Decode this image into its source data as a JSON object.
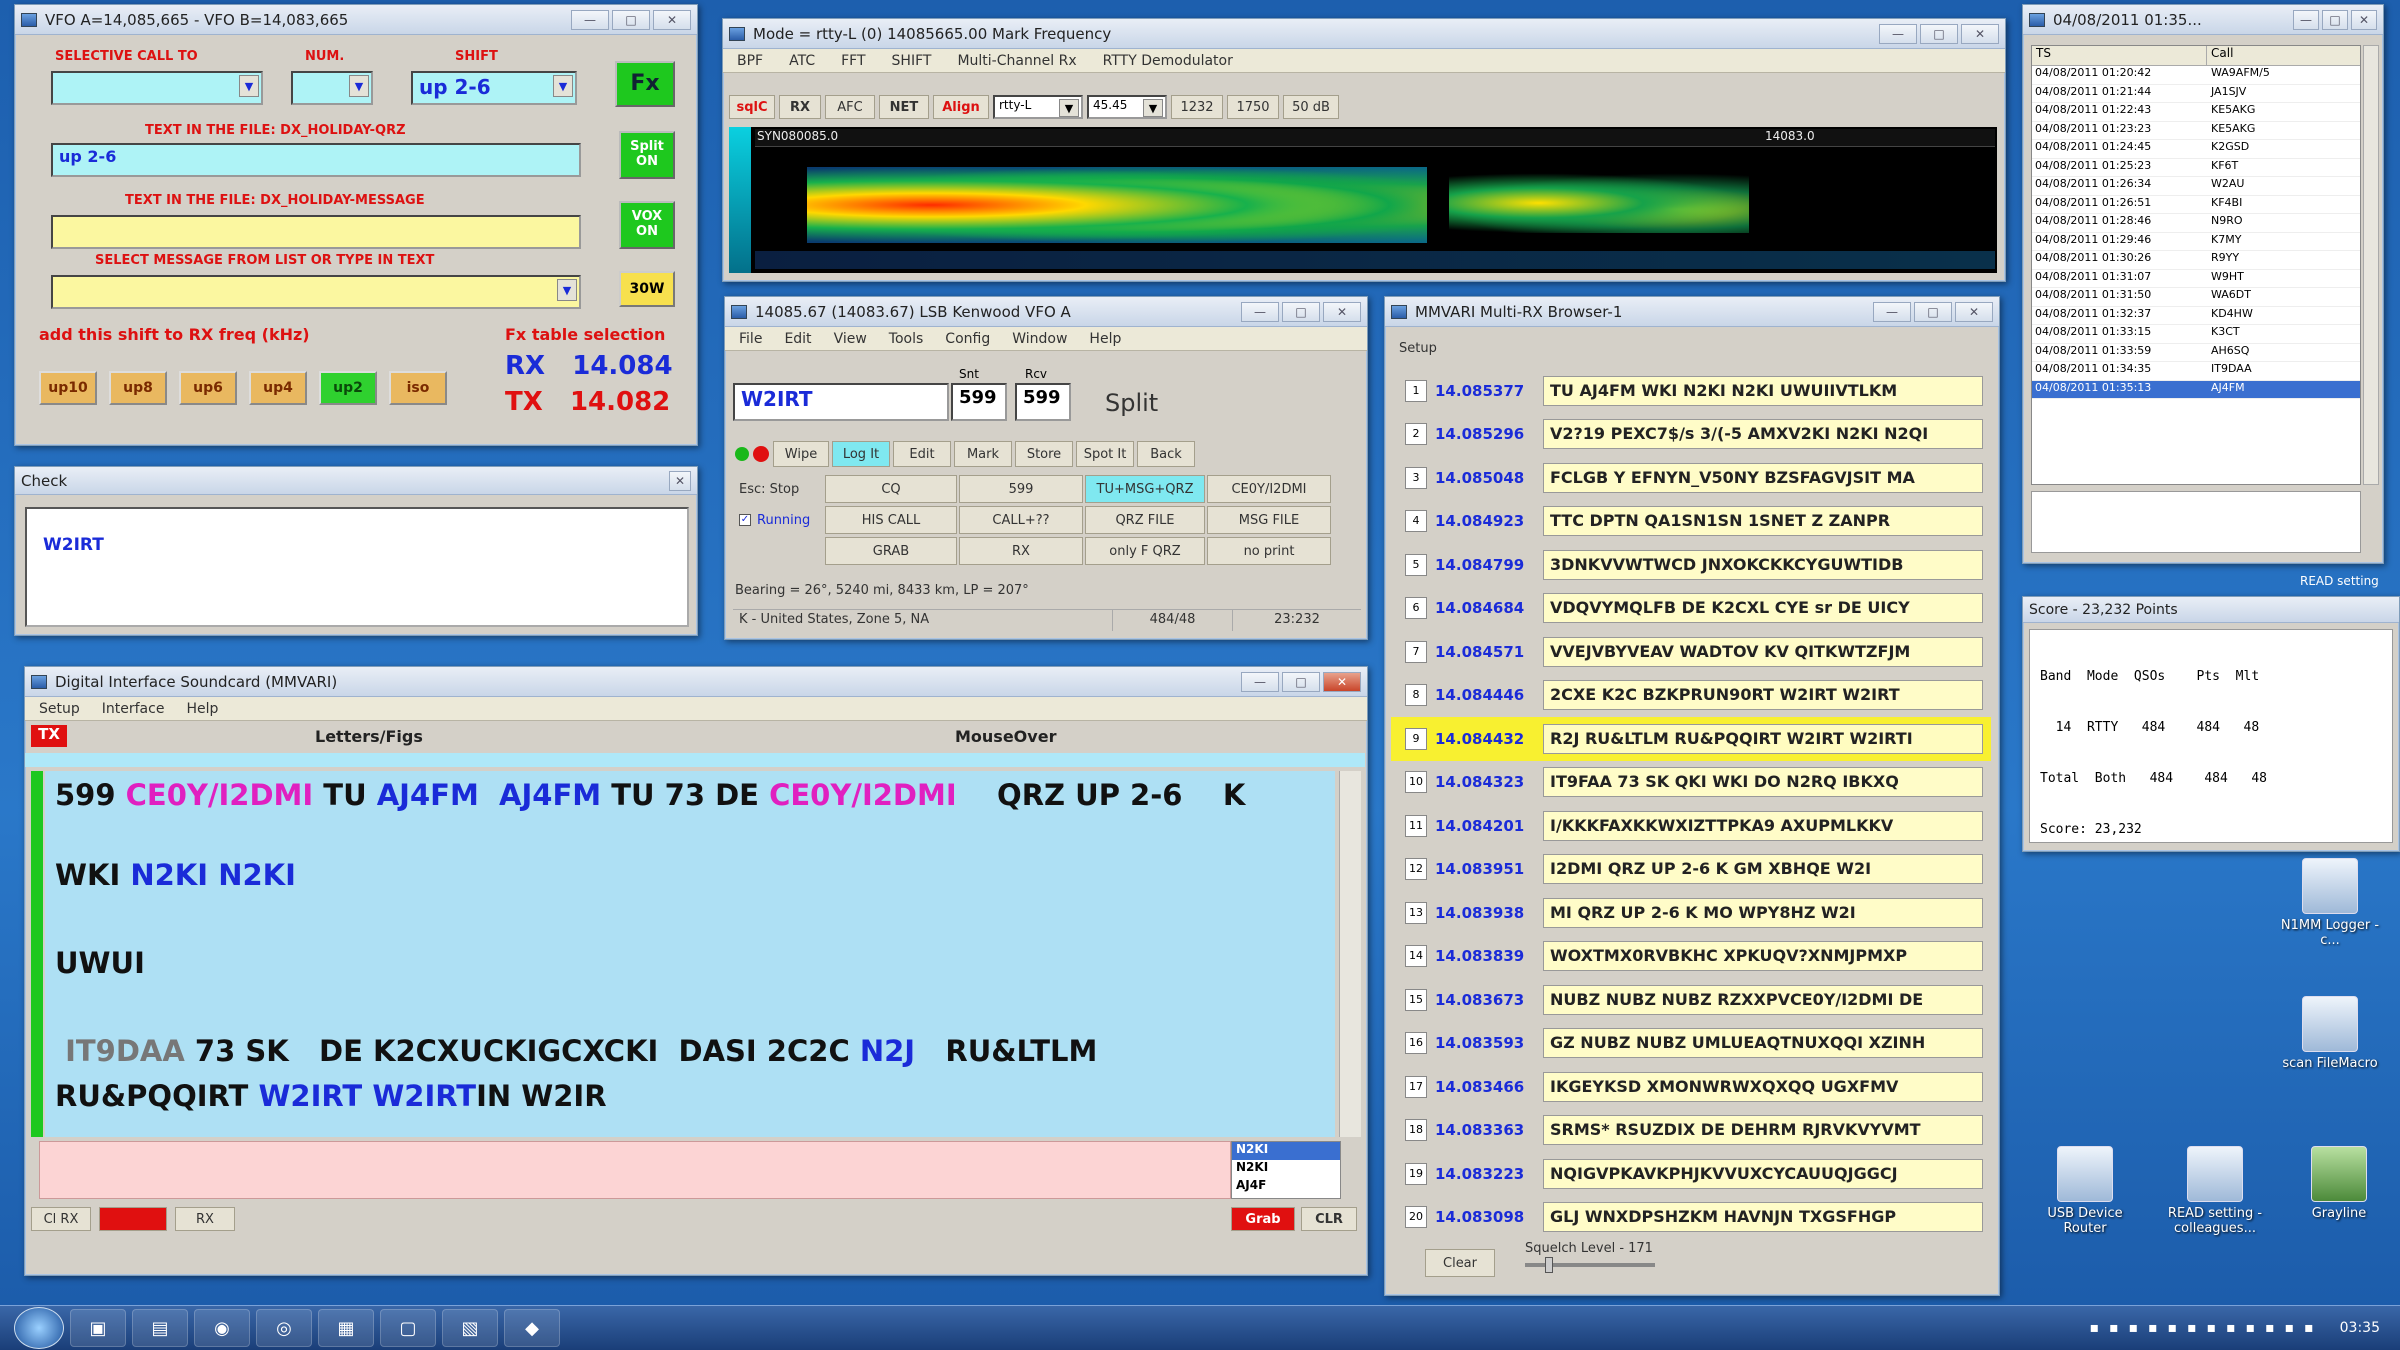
{
  "vfo": {
    "title": "VFO A=14,085,665 - VFO B=14,083,665",
    "selective_call_label": "SELECTIVE CALL TO",
    "num_label": "NUM.",
    "shift_label": "SHIFT",
    "shift_value": "up 2-6",
    "file_qrz_label": "TEXT IN THE FILE: DX_HOLIDAY-QRZ",
    "file_qrz_value": "up 2-6",
    "file_msg_label": "TEXT IN THE FILE: DX_HOLIDAY-MESSAGE",
    "select_msg_label": "SELECT MESSAGE FROM LIST OR TYPE IN TEXT",
    "shift_rx_label": "add this shift to RX freq (kHz)",
    "table_sel_label": "Fx table selection",
    "rx_label": "RX",
    "rx_value": "14.084",
    "tx_label": "TX",
    "tx_value": "14.082",
    "fx_btn": "Fx",
    "split_btn": "Split ON",
    "vox_btn": "VOX ON",
    "w_btn": "30W",
    "shift_buttons": [
      "up10",
      "up8",
      "up6",
      "up4",
      "up2",
      "iso"
    ],
    "active_shift": 4
  },
  "check": {
    "title": "Check",
    "value": "W2IRT"
  },
  "mode": {
    "title": "Mode = rtty-L (0) 14085665.00 Mark Frequency",
    "menu": [
      "BPF",
      "ATC",
      "FFT",
      "SHIFT",
      "Multi-Channel Rx",
      "RTTY Demodulator"
    ],
    "toolbar": [
      "sqlC",
      "RX",
      "AFC",
      "NET",
      "Align"
    ],
    "mode_value": "rtty-L",
    "baud_value": "45.45",
    "mark_value": "1232",
    "space_value": "1750",
    "shift_value": "50 dB",
    "waterfall_label_left": "SYN080085.0",
    "waterfall_label_right": "14083.0"
  },
  "logger": {
    "title": "14085.67 (14083.67) LSB Kenwood VFO A",
    "menu": [
      "File",
      "Edit",
      "View",
      "Tools",
      "Config",
      "Window",
      "Help"
    ],
    "snt_label": "Snt",
    "rcv_label": "Rcv",
    "call_value": "W2IRT",
    "snt_value": "599",
    "rcv_value": "599",
    "split_label": "Split",
    "toolbar": [
      "Wipe",
      "Log It",
      "Edit",
      "Mark",
      "Store",
      "Spot It",
      "Back"
    ],
    "grid": [
      [
        "Esc: Stop",
        "CQ",
        "599",
        "TU+MSG+QRZ",
        "CE0Y/I2DMI"
      ],
      [
        "Running",
        "HIS CALL",
        "CALL+??",
        "QRZ FILE",
        "MSG FILE"
      ],
      [
        "",
        "GRAB",
        "RX",
        "only F QRZ",
        "no print"
      ]
    ],
    "bearing": "Bearing = 26°, 5240 mi, 8433 km, LP = 207°",
    "country": "K - United States, Zone 5, NA",
    "qso_count": "484/48",
    "time": "23:232"
  },
  "multirx": {
    "title": "MMVARI Multi-RX Browser-1",
    "setup": "Setup",
    "rows": [
      {
        "n": "1",
        "freq": "14.085377",
        "text": "TU AJ4FM   WKI N2KI N2KI  UWUIIVTLKM"
      },
      {
        "n": "2",
        "freq": "14.085296",
        "text": "V2?19 PEXC7$/s 3/(-5 AMXV2KI N2KI N2QI"
      },
      {
        "n": "3",
        "freq": "14.085048",
        "text": "FCLGB Y EFNYN_V50NY BZSFAGVJSIT MA"
      },
      {
        "n": "4",
        "freq": "14.084923",
        "text": "TTC    DPTN QA1SN1SN  1SNET Z ZANPR"
      },
      {
        "n": "5",
        "freq": "14.084799",
        "text": "3DNKVVWTWCD JNXOKCKKCYGUWTIDB"
      },
      {
        "n": "6",
        "freq": "14.084684",
        "text": "VDQVYMQLFB DE K2CXL CYE sr DE UICY"
      },
      {
        "n": "7",
        "freq": "14.084571",
        "text": "VVEJVBYVEAV WADTOV KV QITKWTZFJM"
      },
      {
        "n": "8",
        "freq": "14.084446",
        "text": "2CXE K2C BZKPRUN90RT W2IRT W2IRT"
      },
      {
        "n": "9",
        "freq": "14.084432",
        "text": "R2J RU&LTLM RU&PQQIRT W2IRT W2IRTI"
      },
      {
        "n": "10",
        "freq": "14.084323",
        "text": "IT9FAA 73 SK QKI WKI DO N2RQ IBKXQ"
      },
      {
        "n": "11",
        "freq": "14.084201",
        "text": "I/KKKFAXKKWXIZTTPKA9   AXUPMLKKV"
      },
      {
        "n": "12",
        "freq": "14.083951",
        "text": "I2DMI     QRZ UP 2-6   K    GM XBHQE W2I"
      },
      {
        "n": "13",
        "freq": "14.083938",
        "text": "MI    QRZ UP 2-6   K    MO   WPY8HZ W2I"
      },
      {
        "n": "14",
        "freq": "14.083839",
        "text": "WOXTMX0RVBKHC XPKUQV?XNMJPMXP"
      },
      {
        "n": "15",
        "freq": "14.083673",
        "text": "NUBZ NUBZ NUBZ RZXXPVCE0Y/I2DMI DE"
      },
      {
        "n": "16",
        "freq": "14.083593",
        "text": "GZ NUBZ NUBZ UMLUEAQTNUXQQI XZINH"
      },
      {
        "n": "17",
        "freq": "14.083466",
        "text": "IKGEYKSD  XMONWRWXQXQQ UGXFMV"
      },
      {
        "n": "18",
        "freq": "14.083363",
        "text": "SRMS* RSUZDIX DE DEHRM RJRVKVYVMT"
      },
      {
        "n": "19",
        "freq": "14.083223",
        "text": "NQIGVPKAVKPHJKVVUXCYCAUUQJGGCJ"
      },
      {
        "n": "20",
        "freq": "14.083098",
        "text": "GLJ WNXDPSHZKM HAVNJN TXGSFHGP"
      }
    ],
    "highlight_index": 8,
    "clear_btn": "Clear",
    "squelch": "Squelch Level - 171"
  },
  "loglist": {
    "title": "04/08/2011 01:35...",
    "col1": "TS",
    "col2": "Call",
    "rows": [
      [
        "04/08/2011 01:20:42",
        "WA9AFM/5"
      ],
      [
        "04/08/2011 01:21:44",
        "JA1SJV"
      ],
      [
        "04/08/2011 01:22:43",
        "KE5AKG"
      ],
      [
        "04/08/2011 01:23:23",
        "KE5AKG"
      ],
      [
        "04/08/2011 01:24:45",
        "K2GSD"
      ],
      [
        "04/08/2011 01:25:23",
        "KF6T"
      ],
      [
        "04/08/2011 01:26:34",
        "W2AU"
      ],
      [
        "04/08/2011 01:26:51",
        "KF4BI"
      ],
      [
        "04/08/2011 01:28:46",
        "N9RO"
      ],
      [
        "04/08/2011 01:29:46",
        "K7MY"
      ],
      [
        "04/08/2011 01:30:26",
        "R9YY"
      ],
      [
        "04/08/2011 01:31:07",
        "W9HT"
      ],
      [
        "04/08/2011 01:31:50",
        "WA6DT"
      ],
      [
        "04/08/2011 01:32:37",
        "KD4HW"
      ],
      [
        "04/08/2011 01:33:15",
        "K3CT"
      ],
      [
        "04/08/2011 01:33:59",
        "AH6SQ"
      ],
      [
        "04/08/2011 01:34:35",
        "IT9DAA"
      ],
      [
        "04/08/2011 01:35:13",
        "AJ4FM"
      ]
    ],
    "selected_index": 17
  },
  "score": {
    "title": "Score - 23,232 Points",
    "line1": "Band  Mode  QSOs    Pts  Mlt",
    "line2": "  14  RTTY   484    484   48",
    "line3": "Total  Both   484    484   48",
    "line4": "Score: 23,232"
  },
  "mmvari": {
    "title": "Digital Interface Soundcard (MMVARI)",
    "menu": [
      "Setup",
      "Interface",
      "Help"
    ],
    "tx_badge": "TX",
    "letters_label": "Letters/Figs",
    "mouseover_label": "MouseOver",
    "line1": [
      {
        "t": "599 ",
        "c": "k"
      },
      {
        "t": "CE0Y/I2DMI",
        "c": "m"
      },
      {
        "t": " TU ",
        "c": "k"
      },
      {
        "t": "AJ4FM",
        "c": "b"
      },
      {
        "t": "  ",
        "c": "k"
      },
      {
        "t": "AJ4FM",
        "c": "b"
      },
      {
        "t": " TU 73 DE ",
        "c": "k"
      },
      {
        "t": "CE0Y/I2DMI",
        "c": "m"
      },
      {
        "t": "    QRZ UP 2-6    K",
        "c": "k"
      }
    ],
    "line2": [
      {
        "t": "WKI ",
        "c": "k"
      },
      {
        "t": "N2KI",
        "c": "b"
      },
      {
        "t": " ",
        "c": "k"
      },
      {
        "t": "N2KI",
        "c": "b"
      }
    ],
    "line3": [
      {
        "t": "UWUI",
        "c": "k"
      }
    ],
    "line4": [
      {
        "t": " IT9DAA",
        "c": "g"
      },
      {
        "t": " 73 SK   DE K2CXUCKIGCXCKI  DASI 2C2C ",
        "c": "k"
      },
      {
        "t": "N2J",
        "c": "b"
      },
      {
        "t": "   RU&LTLM",
        "c": "k"
      }
    ],
    "line5": [
      {
        "t": "RU&PQQIRT ",
        "c": "k"
      },
      {
        "t": "W2IRT",
        "c": "b"
      },
      {
        "t": " ",
        "c": "k"
      },
      {
        "t": "W2IRT",
        "c": "b"
      },
      {
        "t": "IN W2IR",
        "c": "k"
      }
    ],
    "call_list": [
      "N2KI",
      "N2KI",
      "AJ4F"
    ],
    "bottom_btns": [
      "Cl RX",
      "",
      "RX"
    ],
    "grab_btn": "Grab",
    "clr_btn": "CLR"
  },
  "desktop": {
    "icons": [
      "N1MM Logger - c...",
      "scan FileMacro",
      "USB Device Router",
      "READ setting - colleagues...",
      "Grayline"
    ],
    "read_setting": "READ setting"
  },
  "taskbar": {
    "clock": "03:35"
  }
}
